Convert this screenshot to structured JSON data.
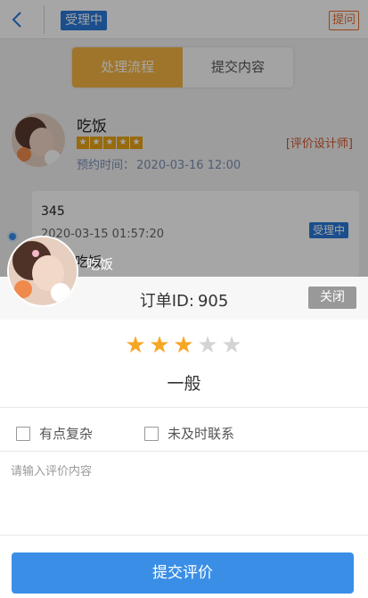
{
  "header": {
    "back_icon": "chevron-left-icon",
    "status": "受理中",
    "ask_label": "提问"
  },
  "tabs": [
    {
      "label": "处理流程",
      "active": true
    },
    {
      "label": "提交内容",
      "active": false
    }
  ],
  "designer": {
    "name": "吃饭",
    "rating_stars": 5,
    "appointment_label": "预约时间：",
    "appointment_time": "2020-03-16 12:00",
    "rate_link": "[评价设计师]"
  },
  "record": {
    "text": "345",
    "time": "2020-03-15 01:57:20",
    "status": "受理中",
    "sub": "吃饭"
  },
  "modal": {
    "order_label": "订单ID:",
    "order_id": "905",
    "close_label": "关闭",
    "avatar_name": "吃饭",
    "rating": {
      "value": 3,
      "max": 5,
      "text": "一般"
    },
    "options": [
      {
        "label": "有点复杂",
        "checked": false
      },
      {
        "label": "未及时联系",
        "checked": false
      }
    ],
    "comment_placeholder": "请输入评价内容",
    "submit_label": "提交评价"
  },
  "colors": {
    "accent_blue": "#3a8ee6",
    "tab_active": "#f5b442",
    "star_on": "#f5a623",
    "star_off": "#d4d4d4",
    "link_orange": "#d0552c"
  }
}
